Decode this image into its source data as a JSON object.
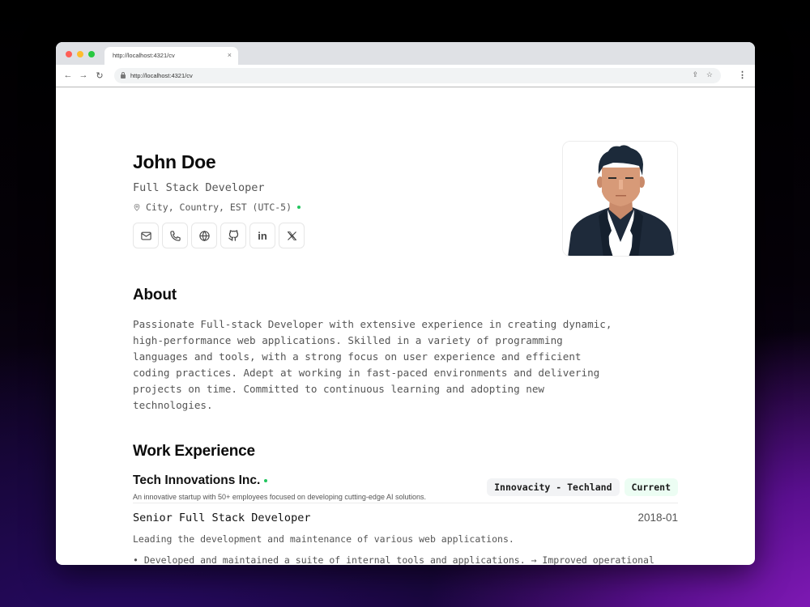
{
  "browser": {
    "tab_title": "http://localhost:4321/cv",
    "tab_close_glyph": "×",
    "url": "http://localhost:4321/cv",
    "back_glyph": "←",
    "forward_glyph": "→",
    "reload_glyph": "↻",
    "share_glyph": "⇪",
    "bookmark_glyph": "☆",
    "menu_glyph": "⋮"
  },
  "profile": {
    "name": "John Doe",
    "title": "Full Stack Developer",
    "location": "City, Country, EST (UTC-5)",
    "socials": [
      {
        "name": "email",
        "icon": "mail-icon"
      },
      {
        "name": "phone",
        "icon": "phone-icon"
      },
      {
        "name": "website",
        "icon": "globe-icon"
      },
      {
        "name": "github",
        "icon": "github-icon"
      },
      {
        "name": "linkedin",
        "icon": "linkedin-icon",
        "label": "in"
      },
      {
        "name": "x",
        "icon": "x-icon",
        "label": "𝕏"
      }
    ],
    "accent_color": "#22c55e"
  },
  "about": {
    "heading": "About",
    "text": "Passionate Full-stack Developer with extensive experience in creating dynamic,\nhigh-performance web applications. Skilled in a variety of programming\nlanguages and tools, with a strong focus on user experience and efficient\ncoding practices. Adept at working in fast-paced environments and delivering\nprojects on time. Committed to continuous learning and adopting new\ntechnologies."
  },
  "work": {
    "heading": "Work Experience",
    "jobs": [
      {
        "company": "Tech Innovations Inc.",
        "description": "An innovative startup with 50+ employees focused on developing cutting-edge AI solutions.",
        "location_badge": "Innovacity - Techland",
        "status_badge": "Current",
        "role": "Senior Full Stack Developer",
        "start": "2018-01",
        "role_description": "Leading the development and maintenance of various web applications.",
        "bullets": [
          "• Developed and maintained a suite of internal tools and applications. → Improved operational"
        ]
      }
    ]
  }
}
